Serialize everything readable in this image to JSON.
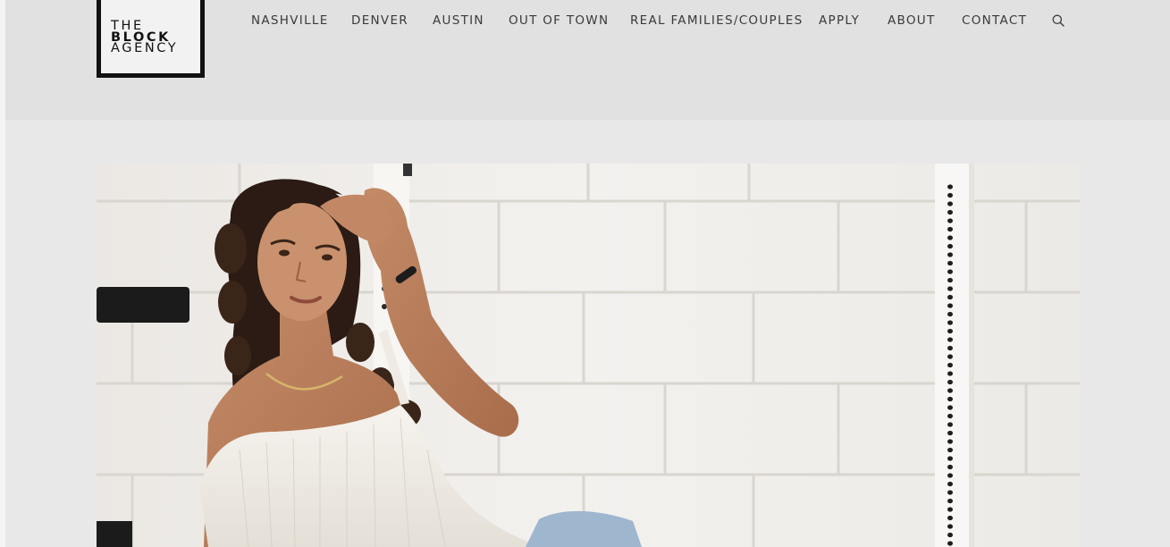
{
  "brand": {
    "logo_lines": [
      "THE",
      "BLOCK",
      "AGENCY"
    ]
  },
  "nav": {
    "items": [
      {
        "id": "nashville",
        "label": "NASHVILLE"
      },
      {
        "id": "denver",
        "label": "DENVER"
      },
      {
        "id": "austin",
        "label": "AUSTIN"
      },
      {
        "id": "out-of-town",
        "label": "OUT OF TOWN"
      },
      {
        "id": "real-families-couples",
        "label": "REAL FAMILIES/COUPLES"
      },
      {
        "id": "apply",
        "label": "APPLY"
      },
      {
        "id": "about",
        "label": "ABOUT"
      },
      {
        "id": "contact",
        "label": "CONTACT"
      }
    ],
    "search_icon": "search-icon"
  },
  "hero": {
    "image": "model-photo"
  },
  "colors": {
    "header_bg": "#e1e1e1",
    "page_bg": "#e9e8e8",
    "text": "#3a3a3a",
    "logo_border": "#111111"
  }
}
